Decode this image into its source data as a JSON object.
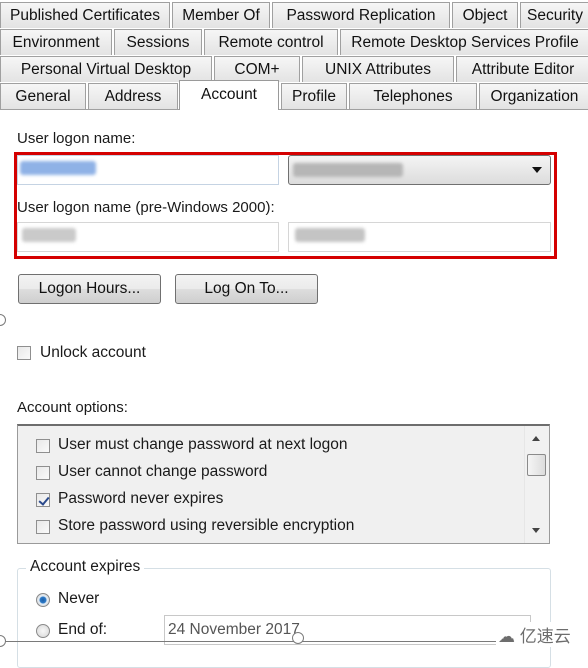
{
  "tabs": {
    "row1": [
      "Published Certificates",
      "Member Of",
      "Password Replication",
      "Object",
      "Security"
    ],
    "row2": [
      "Environment",
      "Sessions",
      "Remote control",
      "Remote Desktop Services Profile"
    ],
    "row3": [
      "Personal Virtual Desktop",
      "COM+",
      "UNIX Attributes",
      "Attribute Editor"
    ],
    "row4": [
      "General",
      "Address",
      "Account",
      "Profile",
      "Telephones",
      "Organization"
    ],
    "active": "Account"
  },
  "logon": {
    "user_logon_name_label": "User logon name:",
    "user_logon_name_value": "",
    "upn_suffix_value": "",
    "pre2000_label": "User logon name (pre-Windows 2000):",
    "pre2000_domain_value": "",
    "pre2000_name_value": "",
    "redacted": true
  },
  "buttons": {
    "logon_hours": "Logon Hours...",
    "log_on_to": "Log On To..."
  },
  "unlock": {
    "label": "Unlock account",
    "checked": false
  },
  "account_options": {
    "label": "Account options:",
    "items": [
      {
        "label": "User must change password at next logon",
        "checked": false
      },
      {
        "label": "User cannot change password",
        "checked": false
      },
      {
        "label": "Password never expires",
        "checked": true
      },
      {
        "label": "Store password using reversible encryption",
        "checked": false
      }
    ]
  },
  "account_expires": {
    "legend": "Account expires",
    "never_label": "Never",
    "end_of_label": "End of:",
    "selected": "Never",
    "end_of_date": "24 November 2017"
  },
  "colors": {
    "highlight_box": "#d40000",
    "radio_selected": "#1c5ea8"
  },
  "watermark": {
    "icon": "cloud-logo-icon",
    "text": "亿速云"
  }
}
